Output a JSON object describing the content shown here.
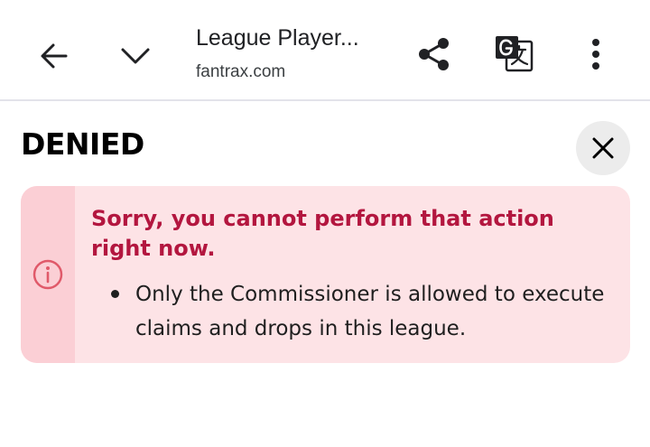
{
  "browser": {
    "title": "League Player...",
    "url": "fantrax.com",
    "icons": {
      "back": "arrow-left-icon",
      "expand": "chevron-down-icon",
      "share": "share-icon",
      "translate": "translate-icon",
      "menu": "more-vert-icon"
    }
  },
  "dialog": {
    "heading": "DENIED",
    "close_icon": "close-icon",
    "alert": {
      "icon": "info-icon",
      "title": "Sorry, you cannot perform that action right now.",
      "items": [
        "Only the Commissioner is allowed to execute claims and drops in this league."
      ],
      "colors": {
        "background": "#fde3e6",
        "strip": "#fbcfd5",
        "title": "#b3163f",
        "icon": "#e05a6a"
      }
    }
  }
}
